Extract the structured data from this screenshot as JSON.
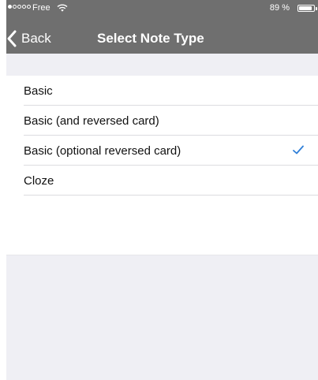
{
  "status_bar": {
    "carrier": "Free",
    "battery_percent": "89 %",
    "battery_level": 0.89,
    "signal_bars_filled": 1,
    "signal_bars_total": 5
  },
  "nav": {
    "back_label": "Back",
    "title": "Select Note Type"
  },
  "note_types": {
    "items": [
      {
        "label": "Basic",
        "selected": false
      },
      {
        "label": "Basic (and reversed card)",
        "selected": false
      },
      {
        "label": "Basic (optional reversed card)",
        "selected": true
      },
      {
        "label": "Cloze",
        "selected": false
      }
    ]
  },
  "colors": {
    "header_bg": "#6f6f6f",
    "group_bg": "#efeff4",
    "accent": "#2f7fd8"
  },
  "icons": {
    "back": "chevron-left-icon",
    "check": "checkmark-icon",
    "wifi": "wifi-icon",
    "battery": "battery-icon"
  }
}
